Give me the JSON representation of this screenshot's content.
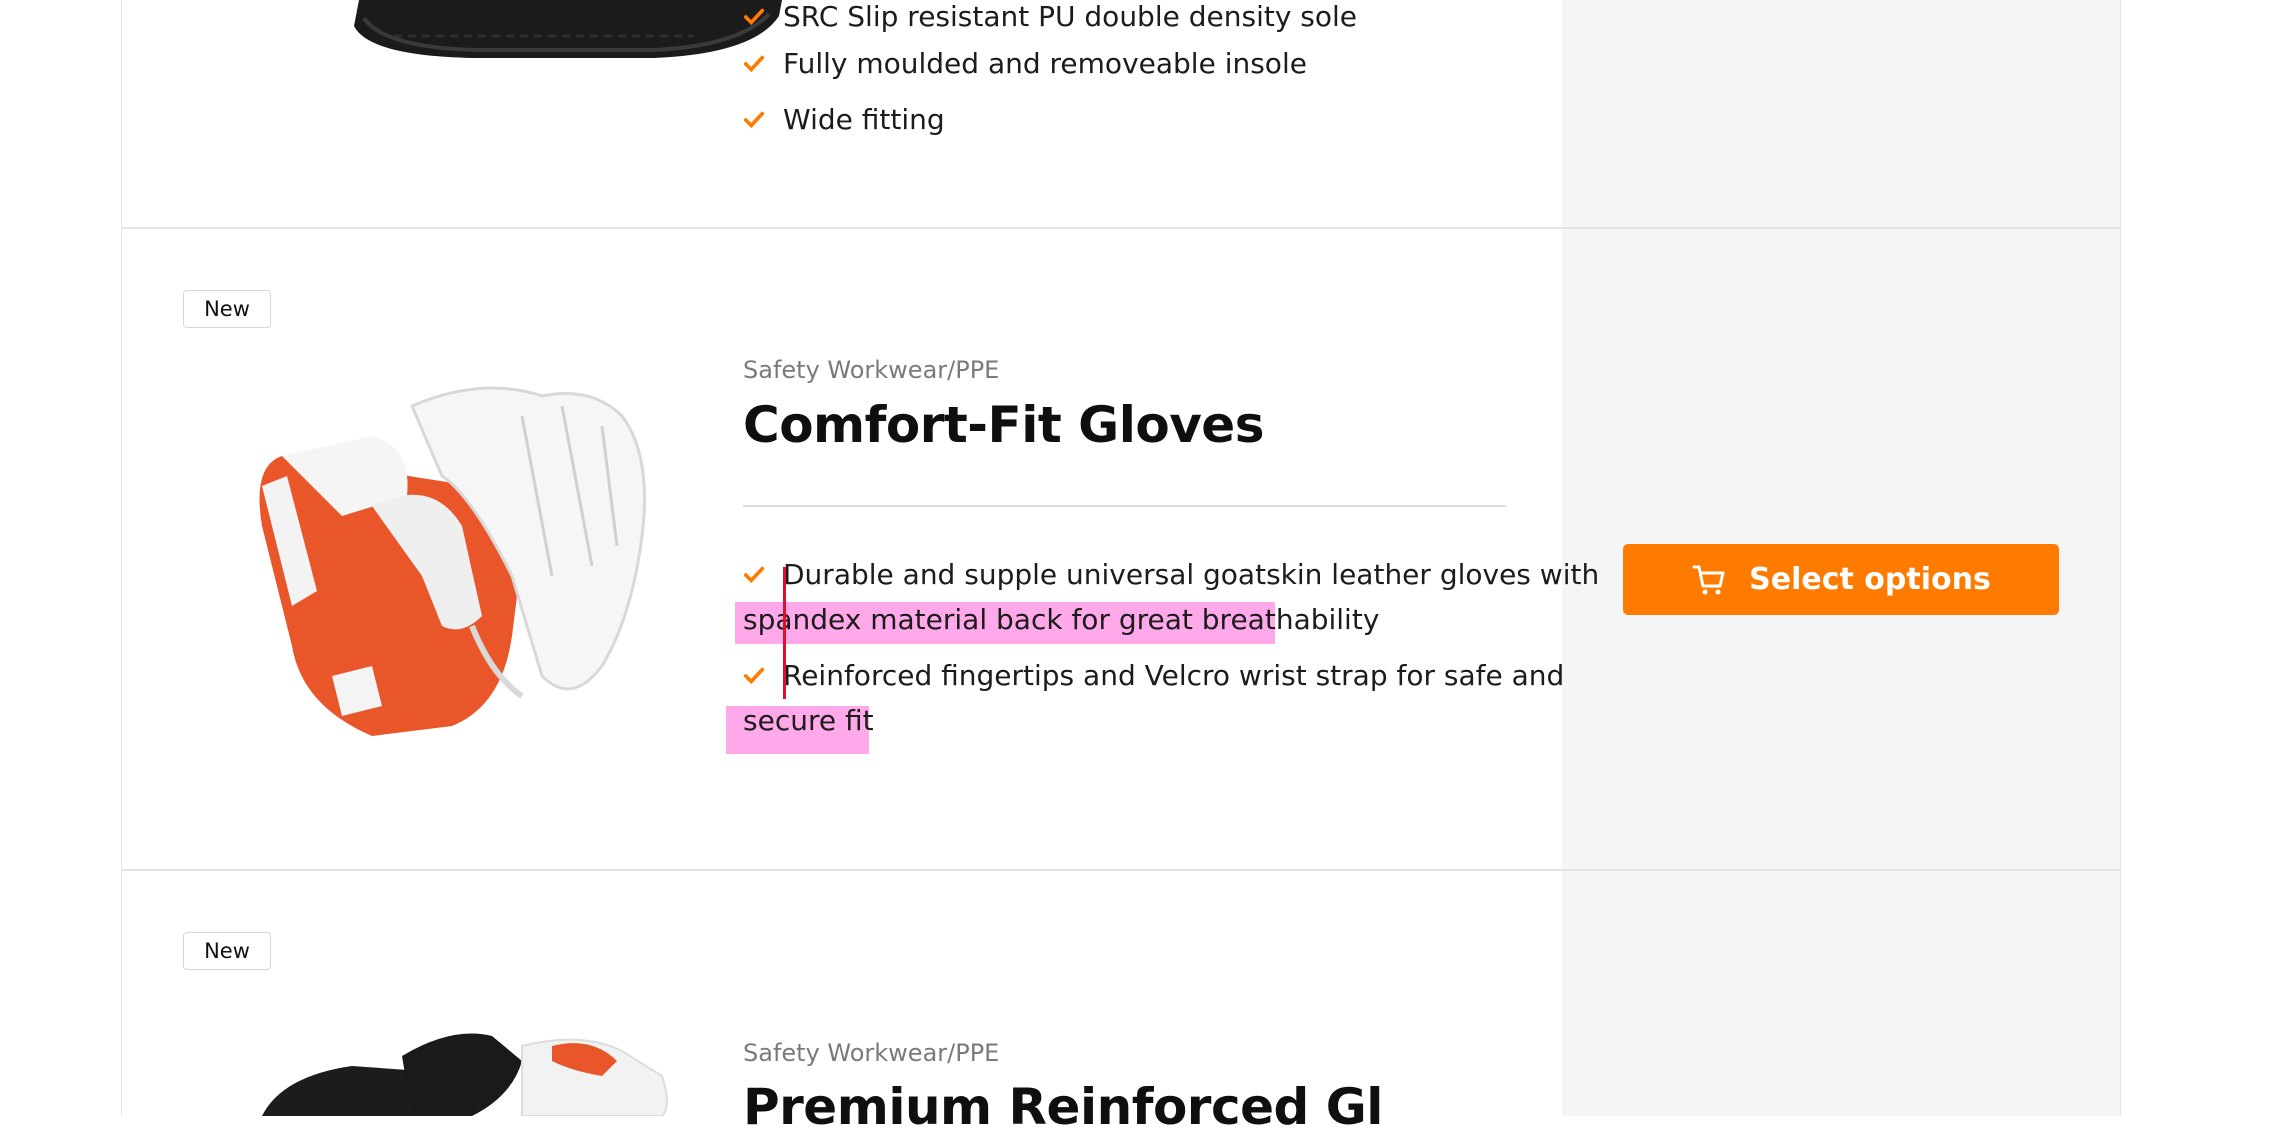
{
  "top_product": {
    "features": [
      "SRC Slip resistant PU double density sole",
      "Fully moulded and removeable insole",
      "Wide fitting"
    ]
  },
  "product": {
    "badge": "New",
    "category": "Safety Workwear/PPE",
    "title": "Comfort-Fit Gloves",
    "feature_1_line_1": "Durable and supple universal goatskin leather gloves with",
    "feature_1_line_2": "spandex material back for great breathability",
    "feature_2_line_1": "Reinforced fingertips and Velcro wrist strap for safe and",
    "feature_2_line_2": "secure fit",
    "button_label": "Select options",
    "button_icon": "cart-icon"
  },
  "next_product": {
    "badge": "New",
    "category": "Safety Workwear/PPE",
    "title_partial": "Premium Reinforced Gl"
  },
  "colors": {
    "accent": "#ff7b00",
    "check": "#ff7b00",
    "side_panel": "#f5f5f5",
    "highlight": "#ff6edc",
    "caret": "#e0102a"
  }
}
